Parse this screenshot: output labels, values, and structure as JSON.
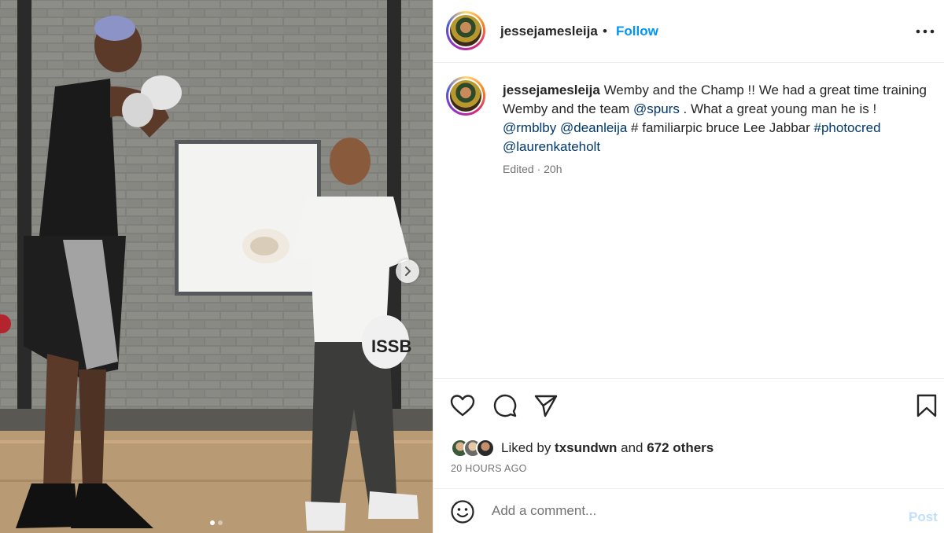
{
  "post": {
    "username": "jessejamesleija",
    "follow_label": "Follow",
    "bullet": "•",
    "caption": {
      "text_1": "Wemby and the Champ !! We had a great time training Wemby and the team ",
      "mention_1": "@spurs",
      "text_2": " . What a great young man he is ! ",
      "mention_2": "@rmblby",
      "text_3": " ",
      "mention_3": "@deanleija",
      "text_4": " # familiarpic bruce Lee Jabbar ",
      "mention_4": "#photocred",
      "text_5": " ",
      "mention_5": "@laurenkateholt"
    },
    "meta": "Edited · 20h",
    "likes": {
      "prefix": "Liked by ",
      "user": "txsundwn",
      "joiner": " and ",
      "others": "672 others"
    },
    "timestamp": "20 HOURS AGO",
    "comment_placeholder": "Add a comment...",
    "post_label": "Post"
  },
  "media": {
    "slide_count": 2,
    "active_slide": 1,
    "jersey_text": "ISSB"
  },
  "icons": {
    "more": "more-options-icon",
    "like": "heart-icon",
    "comment": "comment-bubble-icon",
    "share": "paper-plane-icon",
    "save": "bookmark-icon",
    "emoji": "smiley-icon",
    "next": "chevron-right-icon"
  },
  "colors": {
    "follow": "#0095f6",
    "mention": "#00376b",
    "muted": "#737373",
    "post_disabled": "#c0dffd"
  }
}
